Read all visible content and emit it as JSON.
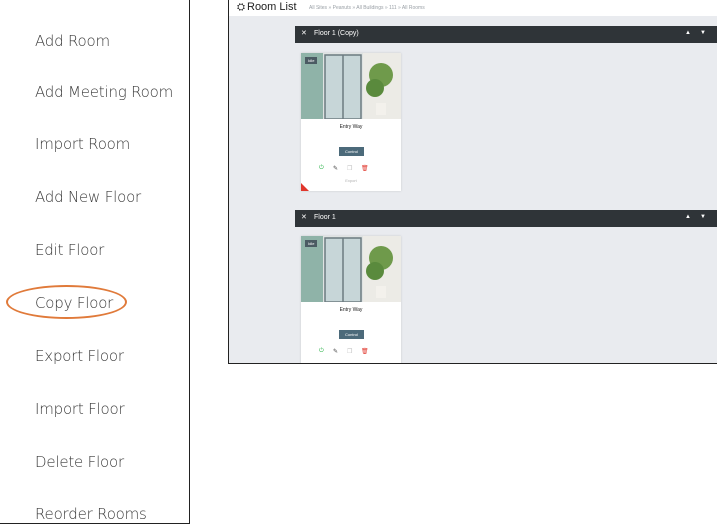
{
  "menu": {
    "items": [
      {
        "label": "Add Room"
      },
      {
        "label": "Add Meeting Room"
      },
      {
        "label": "Import Room"
      },
      {
        "label": "Add New Floor"
      },
      {
        "label": "Edit Floor"
      },
      {
        "label": "Copy Floor"
      },
      {
        "label": "Export Floor"
      },
      {
        "label": "Import Floor"
      },
      {
        "label": "Delete Floor"
      },
      {
        "label": "Reorder Rooms"
      }
    ],
    "highlighted": "Copy Floor",
    "highlight_color": "#e07a3a"
  },
  "room_list": {
    "title": "Room List",
    "title_icon": "room-list-icon",
    "breadcrumb": "All Sites » Peanuts » All Buildings » 111 » All Rooms",
    "floors": [
      {
        "name": "Floor 1 (Copy)",
        "card": {
          "status": "Idle",
          "room_name": "Entry Way",
          "control_label": "Control",
          "export_label": "Export"
        }
      },
      {
        "name": "Floor 1",
        "card": {
          "status": "Idle",
          "room_name": "Entry Way",
          "control_label": "Control",
          "export_label": ""
        }
      }
    ],
    "colors": {
      "floor_bar": "#2f3438",
      "control_button": "#4c6a7a",
      "delete_icon": "#e0362c",
      "power_icon": "#2db34a"
    }
  }
}
